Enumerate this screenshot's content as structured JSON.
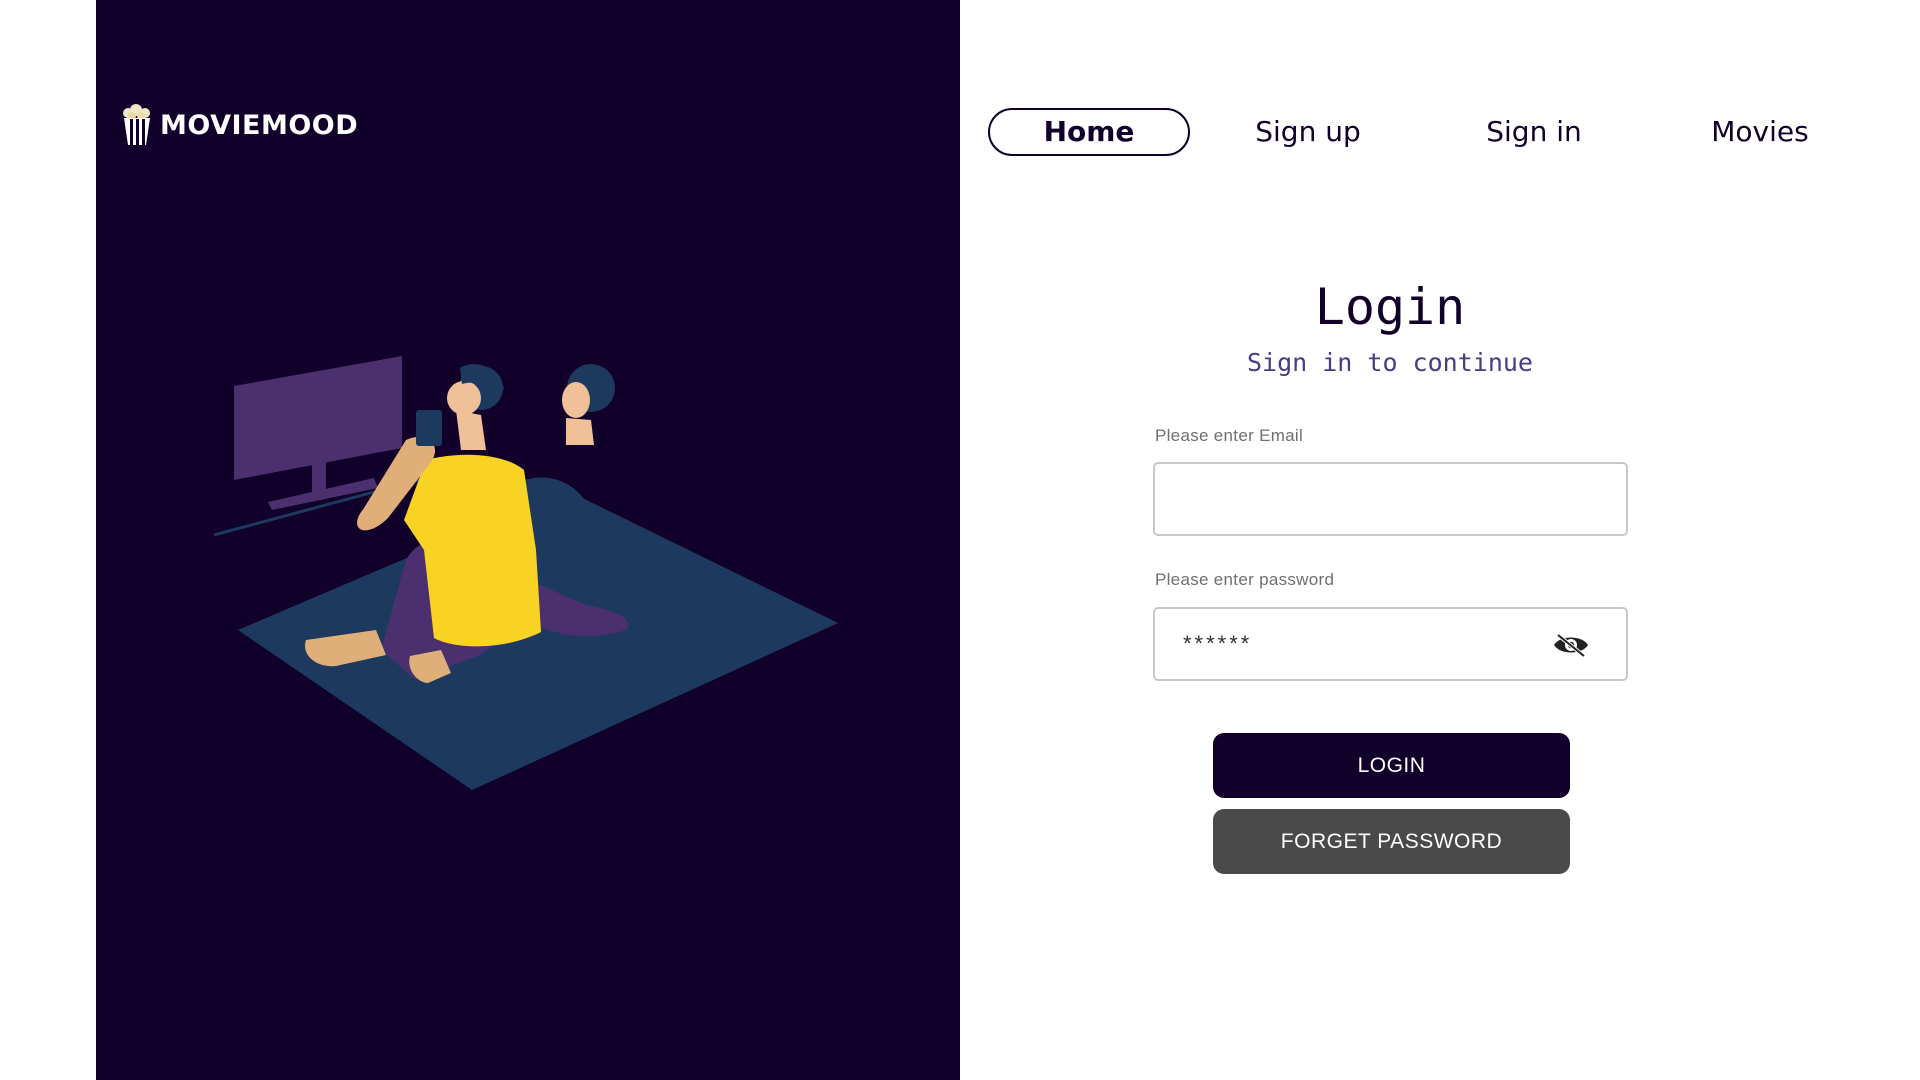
{
  "brand": {
    "name": "MOVIEMOOD",
    "logo_icon": "popcorn-icon"
  },
  "nav": {
    "items": [
      {
        "label": "Home",
        "active": true
      },
      {
        "label": "Sign up",
        "active": false
      },
      {
        "label": "Sign in",
        "active": false
      },
      {
        "label": "Movies",
        "active": false
      }
    ]
  },
  "login": {
    "title": "Login",
    "subtitle": "Sign in to continue",
    "email_label": "Please enter Email",
    "email_value": "",
    "password_label": "Please enter password",
    "password_value": "******",
    "login_button": "LOGIN",
    "forgot_button": "FORGET PASSWORD",
    "toggle_icon": "eye-slash-icon"
  },
  "colors": {
    "primary_dark": "#11002a",
    "accent_purple": "#4b3a86",
    "secondary_button": "#4a4a4a",
    "shirt_yellow": "#f8d323",
    "mat_blue": "#1d3a5e",
    "tv_purple": "#4b2f6e"
  }
}
